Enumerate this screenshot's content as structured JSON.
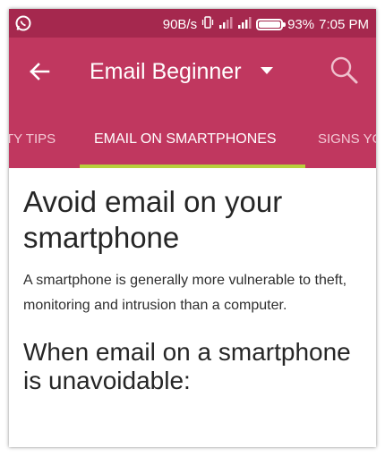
{
  "status_bar": {
    "net_speed": "90B/s",
    "battery_percent": "93%",
    "time": "7:05 PM",
    "icons": [
      "whatsapp-icon",
      "vibrate-icon",
      "signal-icon",
      "signal-data-icon",
      "battery-icon"
    ]
  },
  "app_bar": {
    "title": "Email Beginner",
    "back_icon": "arrow-left-icon",
    "dropdown_icon": "caret-down-icon",
    "search_icon": "search-icon"
  },
  "tabs": [
    {
      "label": "TY TIPS",
      "active": false
    },
    {
      "label": "EMAIL ON SMARTPHONES",
      "active": true
    },
    {
      "label": "SIGNS YO",
      "active": false
    }
  ],
  "content": {
    "heading": "Avoid email on your smartphone",
    "paragraph": "A smartphone is generally more vulnerable to theft, monitoring and intrusion than a computer.",
    "subheading": "When email on a smartphone is unavoidable:"
  },
  "colors": {
    "status_bar": "#a5284e",
    "app_bar": "#c0375f",
    "tab_indicator": "#b7cf3b"
  }
}
